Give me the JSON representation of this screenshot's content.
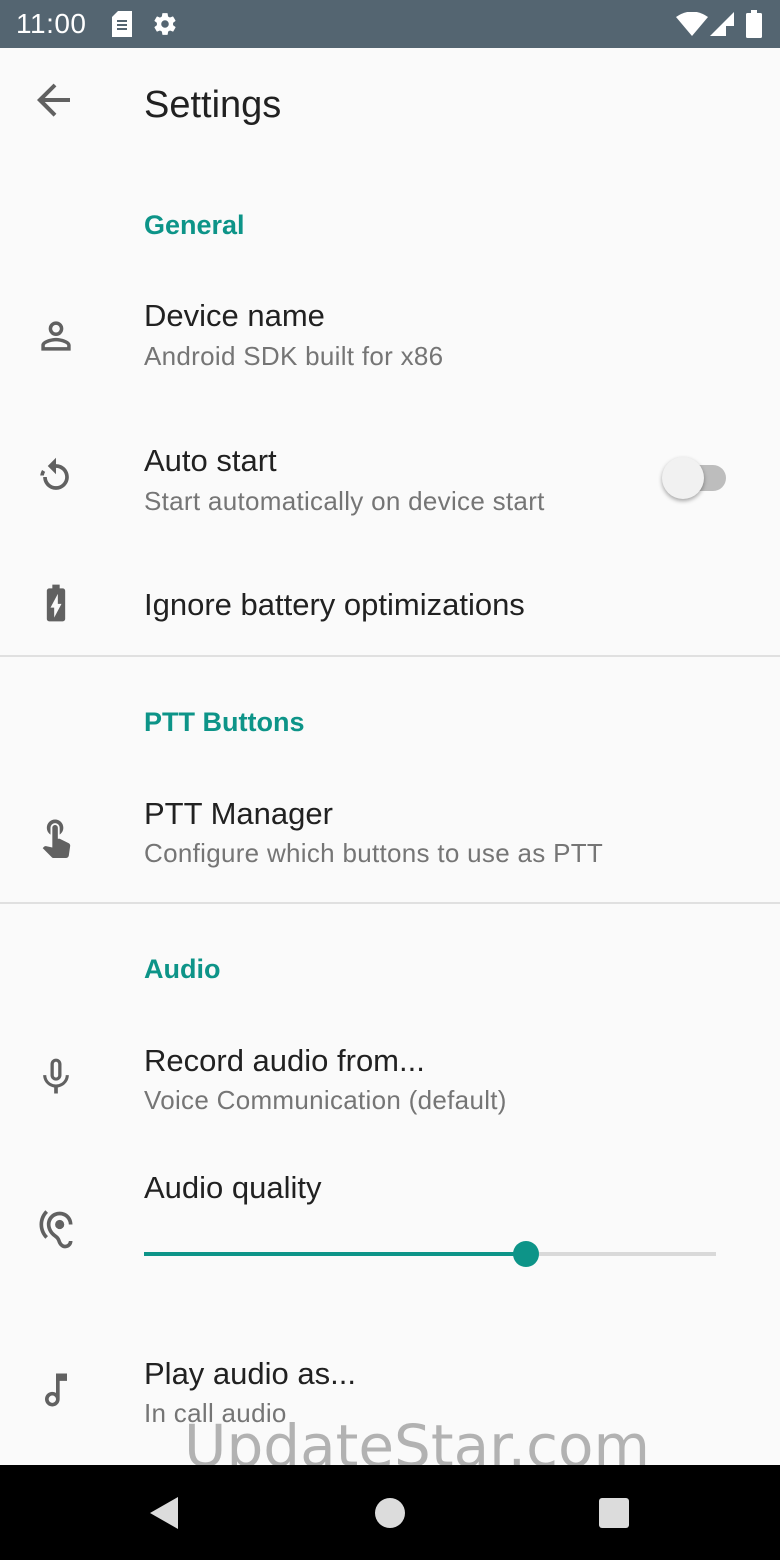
{
  "status_bar": {
    "time": "11:00",
    "left_icons": [
      "sd-card-icon",
      "gear-icon"
    ],
    "right_icons": [
      "wifi-icon",
      "signal-icon",
      "battery-icon"
    ]
  },
  "app_bar": {
    "back_icon": "arrow-back-icon",
    "title": "Settings"
  },
  "sections": {
    "general": {
      "title": "General",
      "device_name": {
        "icon": "person-icon",
        "title": "Device name",
        "summary": "Android SDK built for x86"
      },
      "auto_start": {
        "icon": "restart-icon",
        "title": "Auto start",
        "summary": "Start automatically on device start",
        "enabled": false
      },
      "battery": {
        "icon": "battery-charging-icon",
        "title": "Ignore battery optimizations"
      }
    },
    "ptt": {
      "title": "PTT Buttons",
      "manager": {
        "icon": "touch-icon",
        "title": "PTT Manager",
        "summary": "Configure which buttons to use as PTT"
      }
    },
    "audio": {
      "title": "Audio",
      "record": {
        "icon": "microphone-icon",
        "title": "Record audio from...",
        "summary": "Voice Communication (default)"
      },
      "quality": {
        "icon": "hearing-icon",
        "title": "Audio quality",
        "value_fraction": 0.667
      },
      "play": {
        "icon": "music-note-icon",
        "title": "Play audio as...",
        "summary": "In call audio"
      }
    }
  },
  "watermark": "UpdateStar.com",
  "nav_bar": [
    "back-triangle-icon",
    "home-circle-icon",
    "recents-square-icon"
  ],
  "colors": {
    "accent": "#0d9488",
    "status_bar": "#546571",
    "background": "#fafafa"
  }
}
